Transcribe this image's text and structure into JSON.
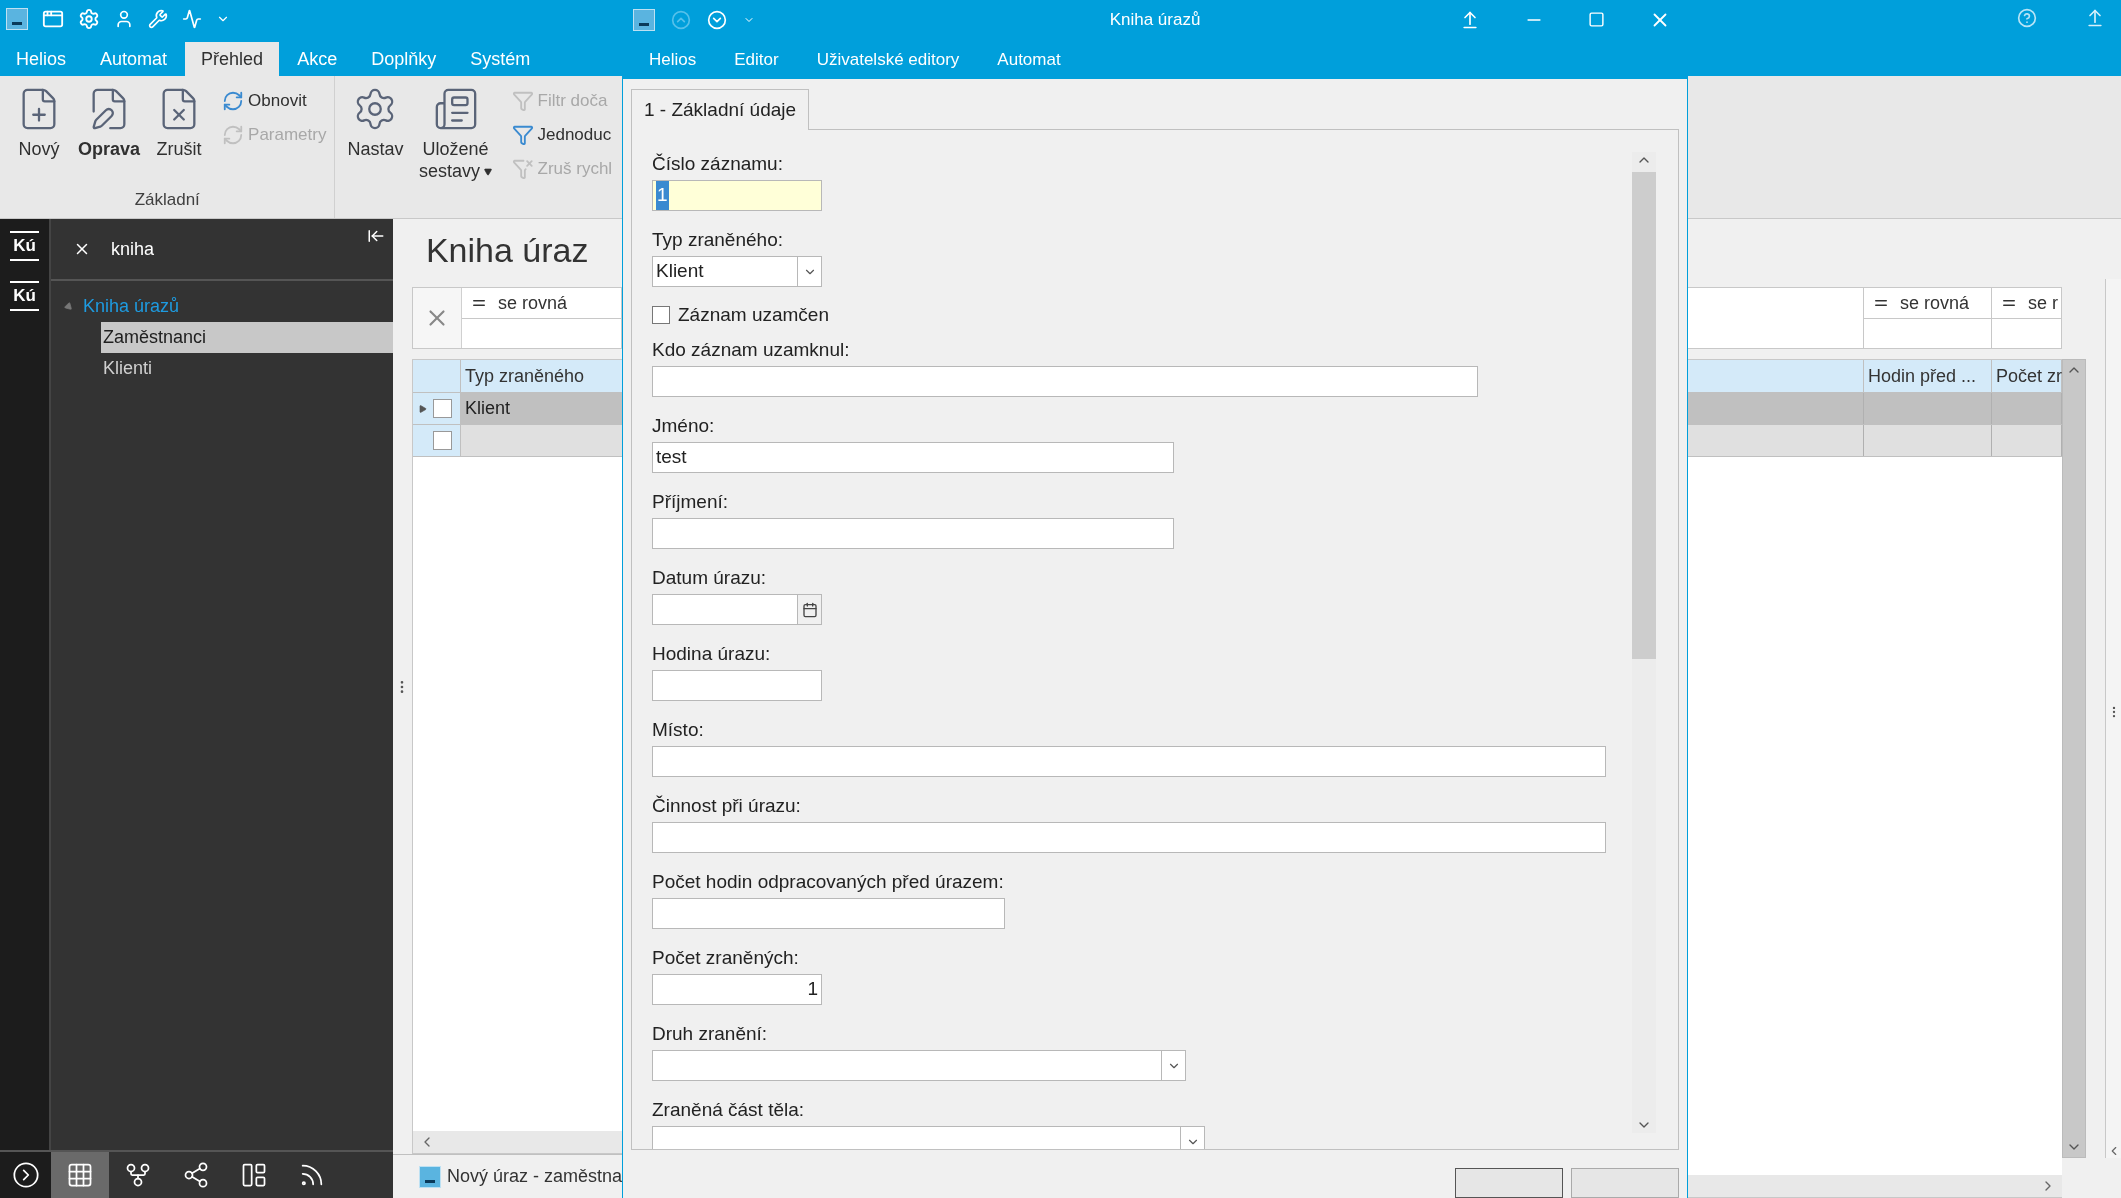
{
  "main_window": {
    "ribbon": {
      "tabs": [
        {
          "label": "Helios",
          "selected": false
        },
        {
          "label": "Automat",
          "selected": false
        },
        {
          "label": "Přehled",
          "selected": true
        },
        {
          "label": "Akce",
          "selected": false
        },
        {
          "label": "Doplňky",
          "selected": false
        },
        {
          "label": "Systém",
          "selected": false
        }
      ],
      "groups": [
        {
          "label": "Základní",
          "items": [
            {
              "kind": "large",
              "label": "Nový",
              "emphasized": false,
              "disabled": false
            },
            {
              "kind": "large",
              "label": "Oprava",
              "emphasized": true,
              "disabled": false
            },
            {
              "kind": "large",
              "label": "Zrušit",
              "emphasized": false,
              "disabled": false
            },
            {
              "kind": "small",
              "label": "Obnovit",
              "disabled": false
            },
            {
              "kind": "small",
              "label": "Parametry",
              "disabled": true
            }
          ]
        },
        {
          "items": [
            {
              "kind": "large",
              "label": "Nastav",
              "emphasized": false,
              "disabled": false
            },
            {
              "kind": "large",
              "label": "Uložené sestavy",
              "emphasized": false,
              "disabled": false,
              "dropdown": true
            },
            {
              "kind": "small",
              "label": "Filtr doča",
              "disabled": true
            },
            {
              "kind": "small",
              "label": "Jednoduc",
              "disabled": false
            },
            {
              "kind": "small",
              "label": "Zruš rychl",
              "disabled": true
            }
          ]
        }
      ]
    },
    "side_badges": [
      "Kú",
      "Kú"
    ],
    "navigator": {
      "search": "kniha",
      "tree": [
        {
          "label": "Kniha úrazů",
          "selected": false,
          "expanded": true,
          "children": [
            {
              "label": "Zaměstnanci",
              "selected": true
            },
            {
              "label": "Klienti",
              "selected": false
            }
          ]
        }
      ]
    },
    "bottom_toolbar": [
      {
        "selected": false
      },
      {
        "selected": true
      },
      {
        "selected": false
      },
      {
        "selected": false
      },
      {
        "selected": false
      },
      {
        "selected": false
      }
    ],
    "left_view": {
      "title": "Kniha úraz",
      "filter": "se rovná",
      "column": "Typ zraněného",
      "rows": [
        {
          "cells": [
            "Klient"
          ],
          "selected": true,
          "checked": false,
          "expandable": true
        },
        {
          "selected": false,
          "checked": false,
          "expandable": false
        }
      ],
      "status": "Nový úraz - zaměstna"
    },
    "right_view": {
      "filters": [
        "se rovná",
        "se r"
      ],
      "columns": [
        "Hodin před ...",
        "Počet zr"
      ],
      "rows": [
        {
          "selected": true
        },
        {
          "selected": false
        }
      ]
    }
  },
  "dialog": {
    "title": "Kniha úrazů",
    "menu": [
      "Helios",
      "Editor",
      "Uživatelské editory",
      "Automat"
    ],
    "tabs": [
      {
        "label": "1 - Základní údaje",
        "selected": true
      }
    ],
    "fields": [
      {
        "kind": "text",
        "label": "Číslo záznamu:",
        "value": "1",
        "focused": true
      },
      {
        "kind": "combo",
        "label": "Typ zraněného:",
        "value": "Klient",
        "focused": false
      },
      {
        "kind": "checkbox",
        "label": "Záznam uzamčen",
        "checked": false
      },
      {
        "kind": "text",
        "label": "Kdo záznam uzamknul:",
        "focused": false
      },
      {
        "kind": "text",
        "label": "Jméno:",
        "value": "test",
        "focused": false
      },
      {
        "kind": "text",
        "label": "Příjmení:",
        "focused": false
      },
      {
        "kind": "date",
        "label": "Datum úrazu:",
        "focused": false
      },
      {
        "kind": "text",
        "label": "Hodina úrazu:",
        "focused": false
      },
      {
        "kind": "text",
        "label": "Místo:",
        "focused": false
      },
      {
        "kind": "text",
        "label": "Činnost při úrazu:",
        "focused": false
      },
      {
        "kind": "text",
        "label": "Počet hodin odpracovaných před úrazem:",
        "focused": false
      },
      {
        "kind": "number",
        "label": "Počet zraněných:",
        "value": "1",
        "focused": false
      },
      {
        "kind": "combo",
        "label": "Druh zranění:",
        "focused": false
      },
      {
        "kind": "combo",
        "label": "Zraněná část těla:",
        "focused": false
      }
    ]
  }
}
